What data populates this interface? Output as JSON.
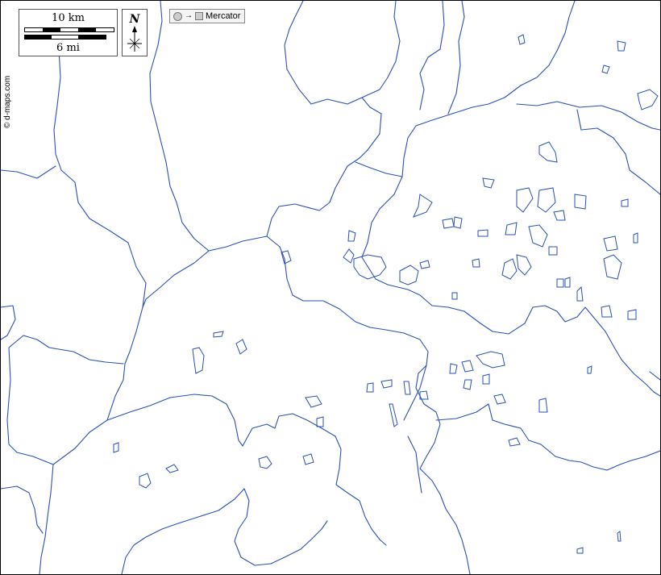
{
  "map": {
    "credit": "© d-maps.com",
    "scale_km": "10 km",
    "scale_mi": "6 mi",
    "north": "N",
    "projection": "Mercator",
    "water_color": "#2b50b8",
    "border_color": "#000000"
  }
}
